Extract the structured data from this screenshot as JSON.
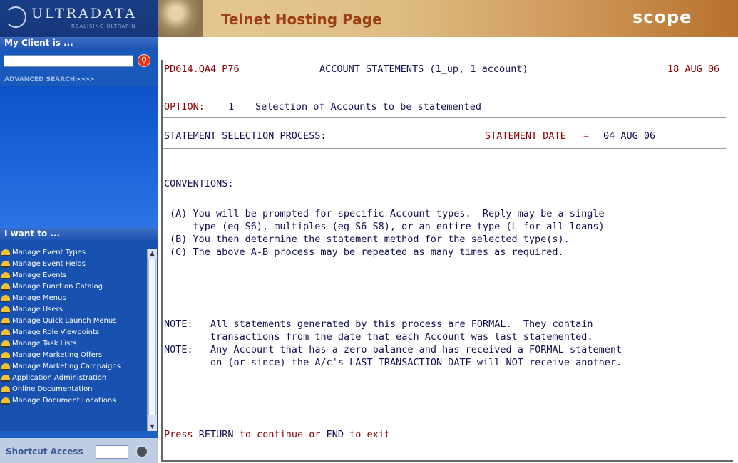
{
  "app": {
    "logo_text": "ULTRADATA",
    "logo_tagline": "REALISING ULTRAFIN",
    "header_title": "Telnet Hosting Page",
    "brand": "scope"
  },
  "sidebar": {
    "client_heading": "My Client is ...",
    "client_input_value": "",
    "advanced_search": "ADVANCED SEARCH",
    "advanced_search_arrows": ">>>>",
    "iwant_heading": "I want to ...",
    "menu_items": [
      {
        "label": "Manage Event Types"
      },
      {
        "label": "Manage Event Fields"
      },
      {
        "label": "Manage Events"
      },
      {
        "label": "Manage Function Catalog"
      },
      {
        "label": "Manage Menus"
      },
      {
        "label": "Manage Users"
      },
      {
        "label": "Manage Quick Launch Menus"
      },
      {
        "label": "Manage Role Viewpoints"
      },
      {
        "label": "Manage Task Lists"
      },
      {
        "label": "Manage Marketing Offers"
      },
      {
        "label": "Manage Marketing Campaigns"
      },
      {
        "label": "Application Administration"
      },
      {
        "label": "Online Documentation"
      },
      {
        "label": "Manage Document Locations"
      }
    ],
    "shortcut_label": "Shortcut Access",
    "shortcut_value": ""
  },
  "terminal": {
    "header_code": "PD614.QA4 P76",
    "header_title": "ACCOUNT STATEMENTS (1_up, 1 account)",
    "header_date": "18 AUG 06",
    "option_label": "OPTION:",
    "option_number": "1",
    "option_text": "Selection of Accounts to be statemented",
    "process_label": "STATEMENT SELECTION PROCESS:",
    "statement_date_label": "STATEMENT DATE",
    "statement_date_eq": "=",
    "statement_date_value": "04 AUG 06",
    "conventions_heading": "CONVENTIONS:",
    "conventions": [
      "(A) You will be prompted for specific Account types.  Reply may be a single",
      "    type (eg S6), multiples (eg S6 S8), or an entire type (L for all loans)",
      "(B) You then determine the statement method for the selected type(s).",
      "(C) The above A-B process may be repeated as many times as required."
    ],
    "notes": [
      "NOTE:   All statements generated by this process are FORMAL.  They contain",
      "        transactions from the date that each Account was last statemented.",
      "NOTE:   Any Account that has a zero balance and has received a FORMAL statement",
      "        on (or since) the A/c's LAST TRANSACTION DATE will NOT receive another."
    ],
    "prompt_press": "Press ",
    "prompt_return": "RETURN",
    "prompt_mid": " to continue or ",
    "prompt_end": "END",
    "prompt_tail": " to exit"
  },
  "colors": {
    "sidebar_blue": "#1d5fc2",
    "terminal_red": "#8c0000",
    "terminal_text": "#101050",
    "header_title": "#9b3d16"
  }
}
